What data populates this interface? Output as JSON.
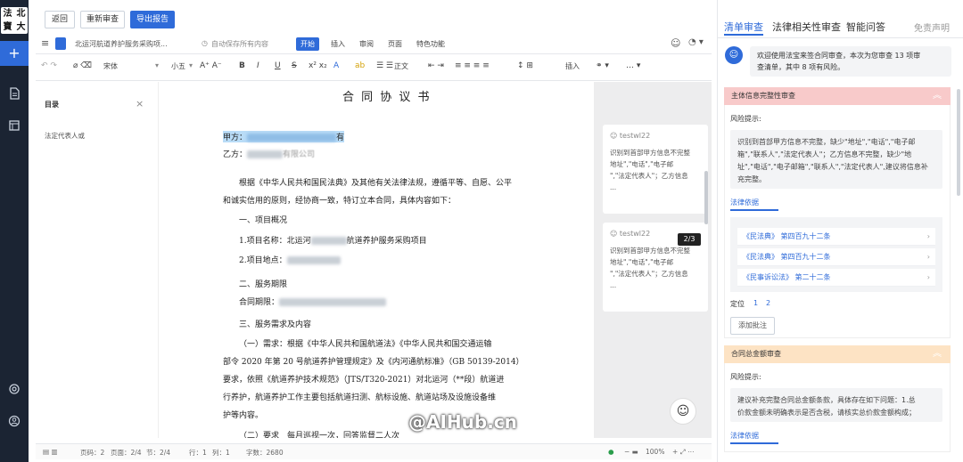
{
  "logo": {
    "chars": [
      "法",
      "北",
      "寶",
      "大"
    ]
  },
  "header": {
    "back": "返回",
    "recheck": "重新审查",
    "export": "导出报告"
  },
  "editor": {
    "doc_title": "北运河航道养护服务采购项...",
    "autosave": "自动保存所有内容",
    "tabs": [
      "开始",
      "插入",
      "审阅",
      "页面",
      "特色功能"
    ],
    "font_name": "宋体",
    "font_size": "小五",
    "para": "正文",
    "insert": "插入"
  },
  "toc": {
    "title": "目录",
    "item": "法定代表人或"
  },
  "document": {
    "title": "合 同 协 议 书",
    "party_a": "甲方：",
    "party_a_tail": "有",
    "party_b": "乙方：",
    "party_b_mid": "有限公司",
    "para1_l1": "根据《中华人民共和国民法典》及其他有关法律法规，遵循平等、自愿、公平",
    "para1_l2": "和诚实信用的原则，经协商一致，特订立本合同，具体内容如下：",
    "s1": "一、项目概况",
    "s1_1": "1.项目名称：北运河",
    "s1_1b": "航道养护服务采购项目",
    "s1_2": "2.项目地点：",
    "s2": "二、服务期限",
    "s2_1": "合同期限：",
    "s3": "三、服务需求及内容",
    "s3_l1": "（一）需求：根据《中华人民共和国航道法》《中华人民共和国交通运输",
    "s3_l2": "部令 2020 年第 20 号航道养护管理规定》及《内河通航标准》（GB 50139-2014）",
    "s3_l3": "要求，依照《航道养护技术规范》（JTS/T320-2021）对北运河（**段）航道进",
    "s3_l4": "行养护，航道养护工作主要包括航道扫测、航标设施、航道站场及设施设备维",
    "s3_l5": "护等内容。",
    "s3_l6": "（二）要求　每月巡视一次，回答监督二人次"
  },
  "comments": [
    {
      "user": "testwl22",
      "l1": "识别到首部甲方信息不完整",
      "l2": "地址\",\"电话\",\"电子邮",
      "l3": "\",\"法定代表人\"；乙方信息",
      "more": "..."
    },
    {
      "user": "testwl22",
      "l1": "识别到首部甲方信息不完整",
      "l2": "地址\",\"电话\",\"电子邮",
      "l3": "\",\"法定代表人\"；乙方信息",
      "more": "..."
    }
  ],
  "page_badge": "2/3",
  "status": {
    "pages": "页码：2",
    "page": "页面：2/4",
    "section": "节：2/4",
    "row": "行：1",
    "col": "列：1",
    "words": "字数：2680",
    "zoom": "100%"
  },
  "right": {
    "tabs": [
      "清单审查",
      "法律相关性审查",
      "智能问答"
    ],
    "disclaimer": "免责声明",
    "welcome_l1": "欢迎使用法宝来签合同审查，本次为您审查 13 项审",
    "welcome_l2": "查清单，其中 8 项有风险。",
    "sec1": {
      "title": "主体信息完整性审查",
      "risk_label": "风险提示:",
      "risk_l1": "识别到首部甲方信息不完整，缺少\"地址\",\"电话\",\"电子邮",
      "risk_l2": "箱\",\"联系人\",\"法定代表人\"；乙方信息不完整，缺少\"地",
      "risk_l3": "址\",\"电话\",\"电子邮箱\",\"联系人\",\"法定代表人\",建议将信息补",
      "risk_l4": "充完整。",
      "basis_label": "法律依据",
      "laws": [
        "《民法典》 第四百九十二条",
        "《民法典》 第四百九十二条",
        "《民事诉讼法》 第二十二条"
      ],
      "locate_label": "定位",
      "locate_1": "1",
      "locate_2": "2",
      "annotate": "添加批注"
    },
    "sec2": {
      "title": "合同总金额审查",
      "risk_label": "风险提示:",
      "risk_l1": "建议补充完整合同总金额条款，具体存在如下问题：1.总",
      "risk_l2": "价款金额未明确表示是否含税，请核实总价款金额构成；",
      "basis_label": "法律依据"
    }
  },
  "watermark": "@AIHub.cn",
  "colors": {
    "accent": "#2f6bd9",
    "rail": "#1b2433",
    "risk_red": "#f8caca",
    "risk_orange": "#fde3c4"
  }
}
